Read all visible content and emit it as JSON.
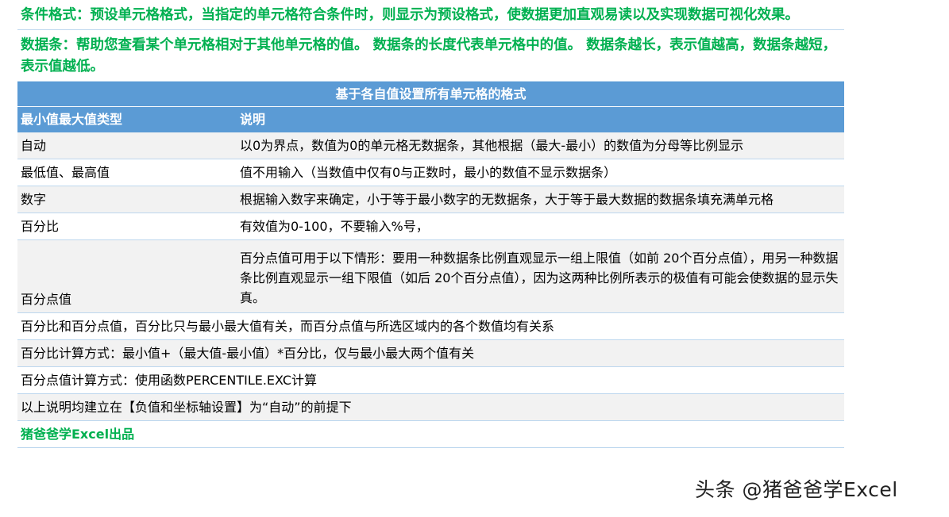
{
  "intro": {
    "line1": "条件格式：预设单元格格式，当指定的单元格符合条件时，则显示为预设格式，使数据更加直观易读以及实现数据可视化效果。",
    "line2": "数据条：帮助您查看某个单元格相对于其他单元格的值。 数据条的长度代表单元格中的值。 数据条越长，表示值越高，数据条越短，表示值越低。"
  },
  "table": {
    "band_title": "基于各自值设置所有单元格的格式",
    "headers": {
      "type": "最小值最大值类型",
      "desc": "说明"
    },
    "rows": [
      {
        "type": "自动",
        "desc": "以0为界点，数值为0的单元格无数据条，其他根据（最大-最小）的数值为分母等比例显示"
      },
      {
        "type": "最低值、最高值",
        "desc": "值不用输入（当数值中仅有0与正数时，最小的数值不显示数据条）"
      },
      {
        "type": "数字",
        "desc": "根据输入数字来确定，小于等于最小数字的无数据条，大于等于最大数据的数据条填充满单元格"
      },
      {
        "type": "百分比",
        "desc": "有效值为0-100，不要输入%号，"
      },
      {
        "type": "百分点值",
        "desc": "百分点值可用于以下情形：要用一种数据条比例直观显示一组上限值（如前 20个百分点值），用另一种数据条比例直观显示一组下限值（如后 20个百分点值），因为这两种比例所表示的极值有可能会使数据的显示失真。"
      }
    ],
    "notes": [
      "百分比和百分点值，百分比只与最小最大值有关，而百分点值与所选区域内的各个数值均有关系",
      "百分比计算方式：最小值+（最大值-最小值）*百分比，仅与最小最大两个值有关",
      "百分点值计算方式：使用函数PERCENTILE.EXC计算",
      "以上说明均建立在【负值和坐标轴设置】为“自动”的前提下"
    ],
    "footer": "猪爸爸学Excel出品"
  },
  "watermark": "头条 @猪爸爸学Excel",
  "colors": {
    "accent_green": "#00b050",
    "header_blue": "#5b9bd5",
    "alt_row": "#f2f2f2"
  }
}
